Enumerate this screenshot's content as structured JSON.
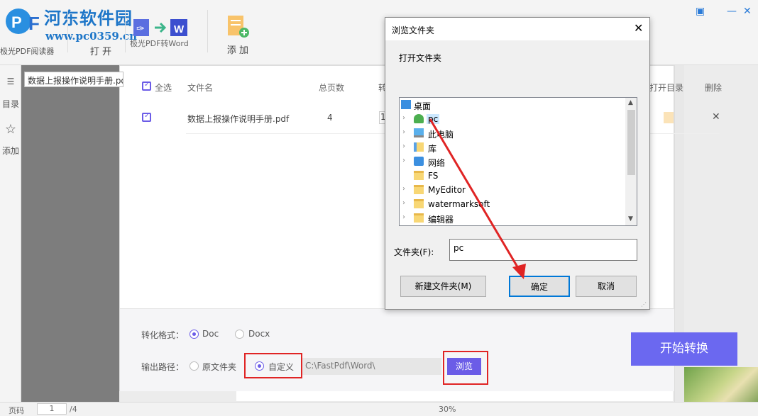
{
  "app": {
    "logo_label": "极光PDF阅读器",
    "watermark_title": "河东软件园",
    "watermark_url": "www.pc0359.cn",
    "open_label": "打 开",
    "convert_label": "极光PDF转Word",
    "add_label": "添 加"
  },
  "left_rail": {
    "toc_label": "目录",
    "bookmark_label": "添加"
  },
  "bottom_bar": {
    "page_label": "页码",
    "page_value": "1",
    "page_total": "/4",
    "zoom": "30%"
  },
  "file_input_value": "数据上报操作说明手册.pdf",
  "table": {
    "select_all": "全选",
    "col_name": "文件名",
    "col_pages": "总页数",
    "col_convert": "转",
    "col_open_dir": "打开目录",
    "col_delete": "删除",
    "rows": [
      {
        "name": "数据上报操作说明手册.pdf",
        "pages": "4",
        "range_start": "1"
      }
    ]
  },
  "settings": {
    "format_label": "转化格式：",
    "format_options": [
      "Doc",
      "Docx"
    ],
    "format_selected": "Doc",
    "output_label": "输出路径：",
    "output_options": [
      "原文件夹",
      "自定义"
    ],
    "output_selected": "自定义",
    "path_value": "C:\\FastPdf\\Word\\",
    "browse_label": "浏览",
    "start_label": "开始转换"
  },
  "dialog": {
    "title": "浏览文件夹",
    "description": "打开文件夹",
    "tree": [
      {
        "label": "桌面",
        "icon": "desktop-icon",
        "level": 0,
        "expand": ""
      },
      {
        "label": "pc",
        "icon": "user-folder-icon",
        "level": 1,
        "expand": "›"
      },
      {
        "label": "此电脑",
        "icon": "computer-icon",
        "level": 1,
        "expand": "›"
      },
      {
        "label": "库",
        "icon": "library-icon",
        "level": 1,
        "expand": "›"
      },
      {
        "label": "网络",
        "icon": "network-icon",
        "level": 1,
        "expand": "›"
      },
      {
        "label": "FS",
        "icon": "folder-icon",
        "level": 1,
        "expand": ""
      },
      {
        "label": "MyEditor",
        "icon": "folder-icon",
        "level": 1,
        "expand": "›"
      },
      {
        "label": "watermarksoft",
        "icon": "folder-icon",
        "level": 1,
        "expand": "›"
      },
      {
        "label": "编辑器",
        "icon": "folder-icon",
        "level": 1,
        "expand": "›"
      }
    ],
    "selected": "pc",
    "folder_label": "文件夹(F):",
    "folder_value": "pc",
    "new_folder_label": "新建文件夹(M)",
    "ok_label": "确定",
    "cancel_label": "取消"
  },
  "colors": {
    "accent": "#6b5ce7",
    "start_button": "#6b68f0",
    "annotation": "#e02424",
    "dialog_focus": "#0078d7"
  }
}
